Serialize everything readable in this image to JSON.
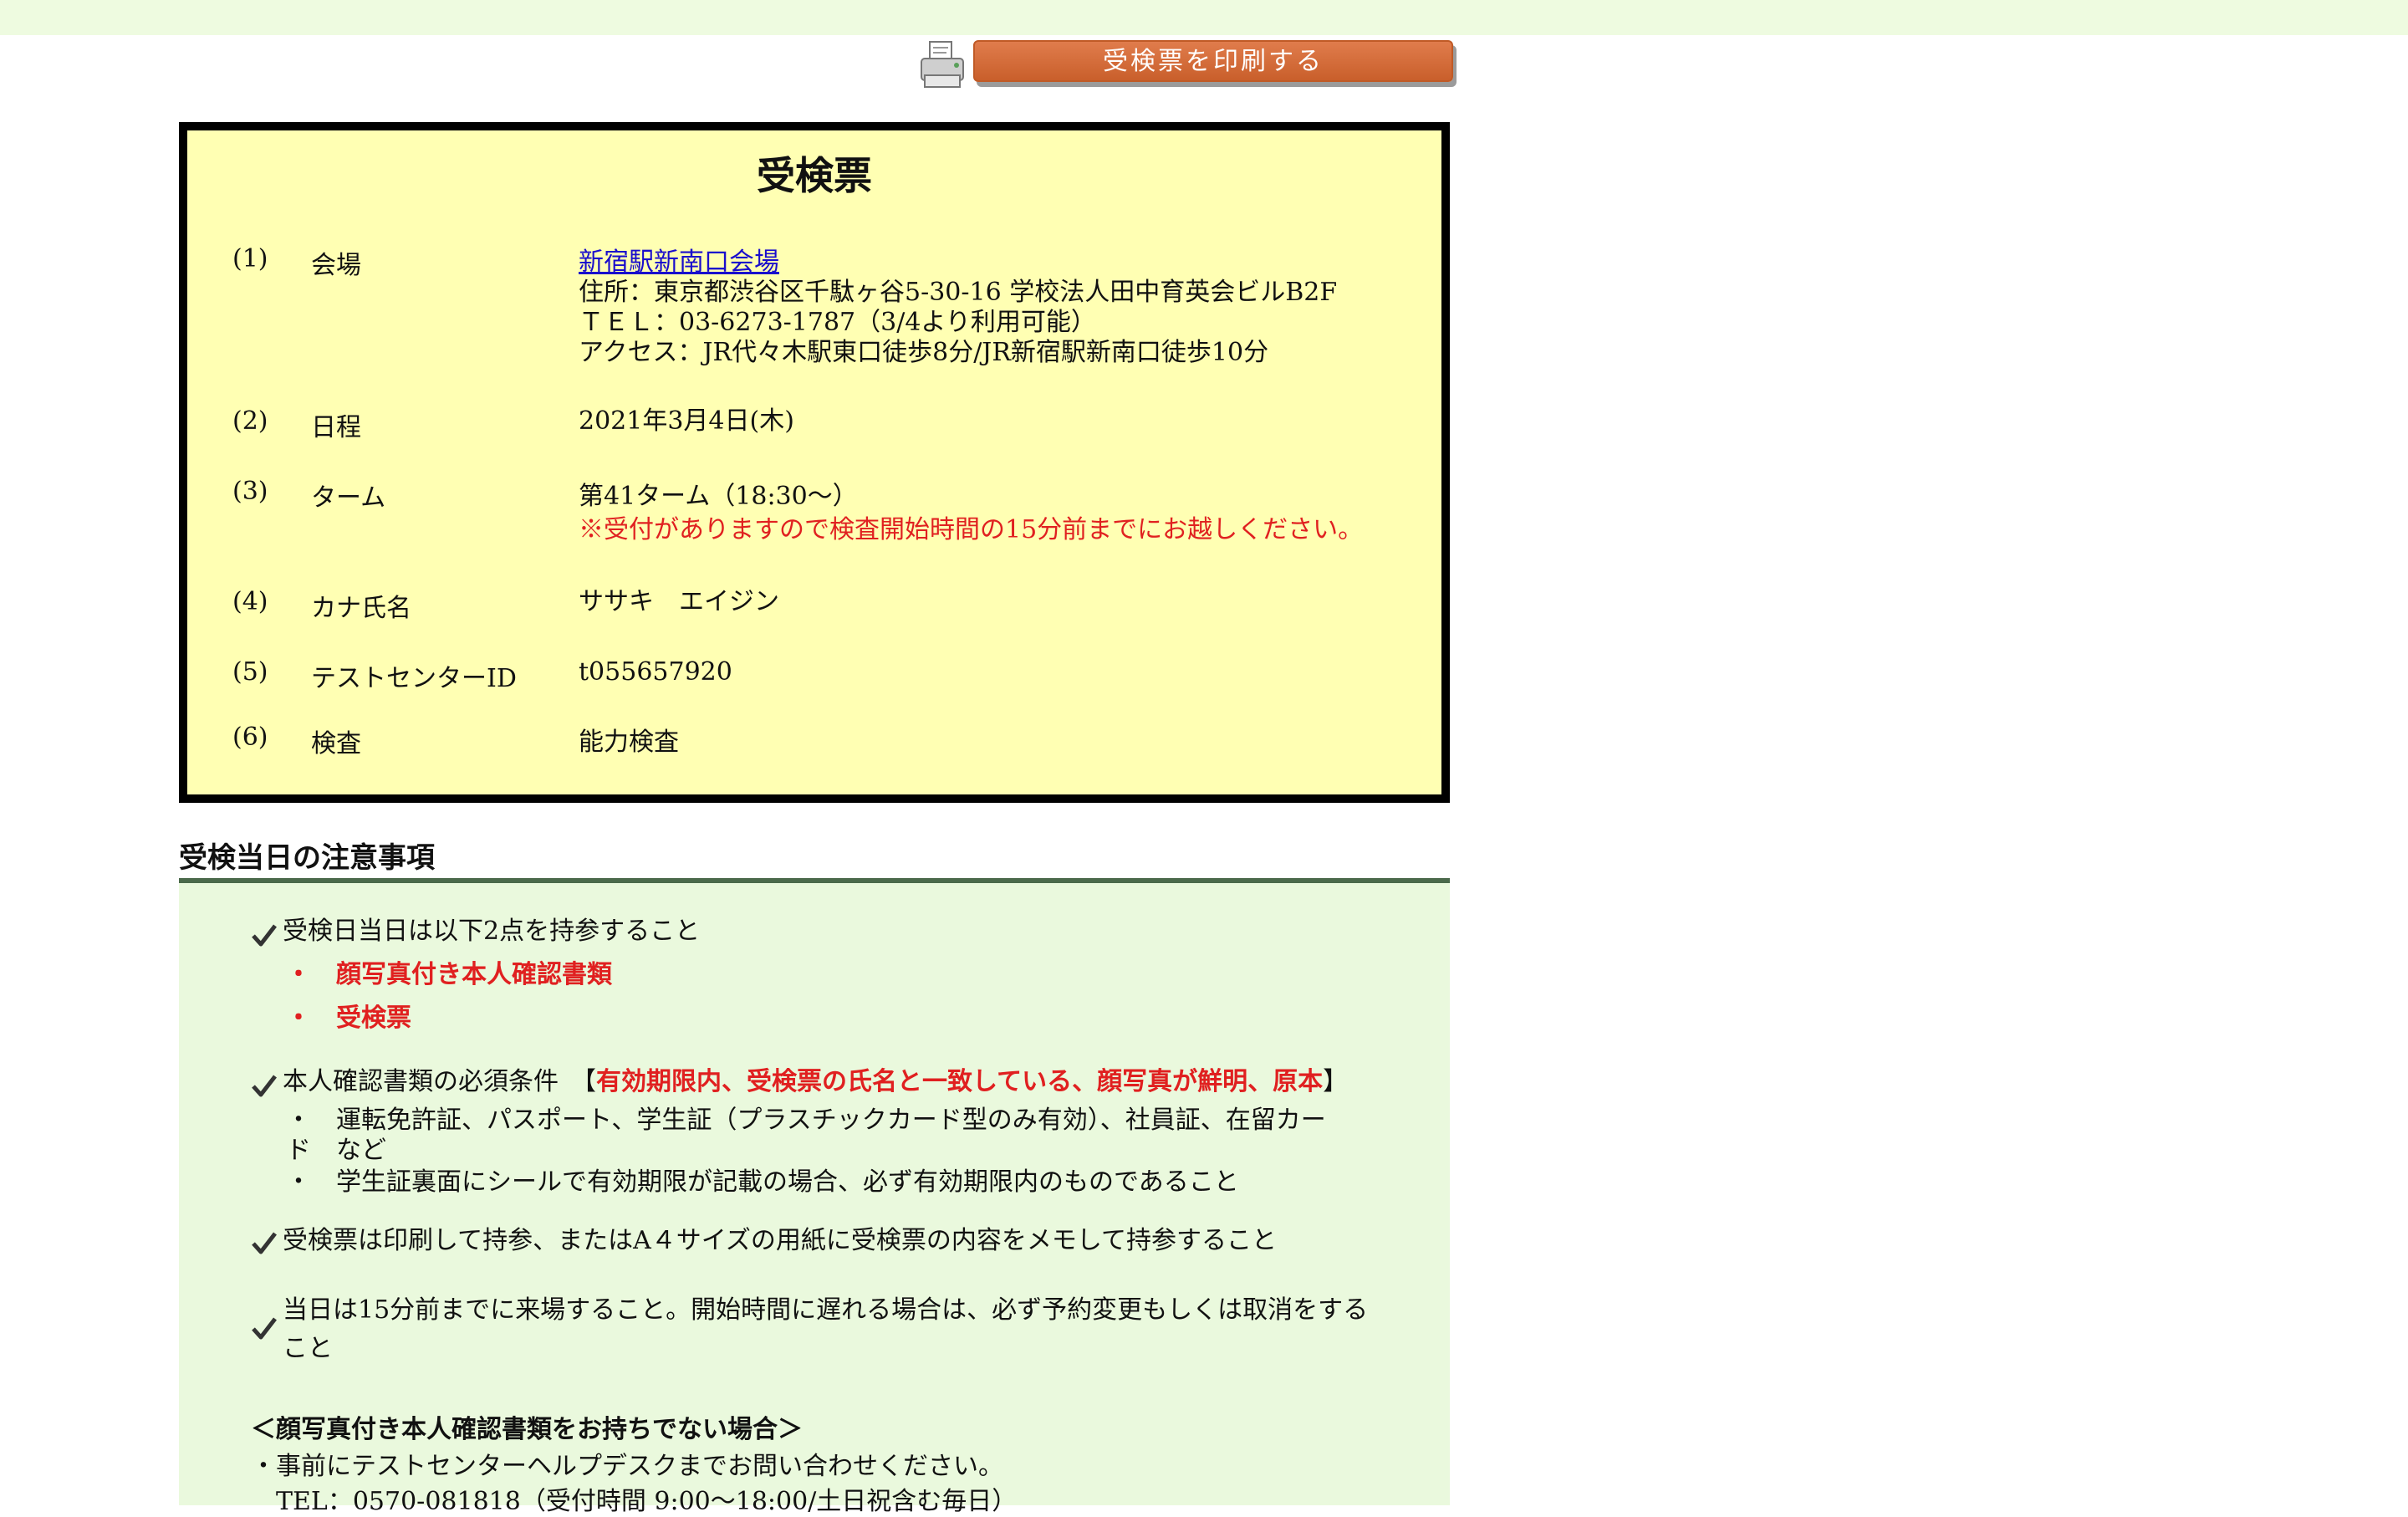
{
  "print_button": {
    "label": "受検票を印刷する"
  },
  "ticket": {
    "title": "受検票",
    "rows": [
      {
        "num": "(1)",
        "label": "会場",
        "venue_link": "新宿駅新南口会場",
        "address": "住所：東京都渋谷区千駄ヶ谷5-30-16 学校法人田中育英会ビルB2F",
        "tel": "ＴＥＬ：03-6273-1787（3/4より利用可能）",
        "access": "アクセス：JR代々木駅東口徒歩8分/JR新宿駅新南口徒歩10分"
      },
      {
        "num": "(2)",
        "label": "日程",
        "value": "2021年3月4日(木)"
      },
      {
        "num": "(3)",
        "label": "ターム",
        "value": "第41ターム（18:30〜）",
        "note": "※受付がありますので検査開始時間の15分前までにお越しください。"
      },
      {
        "num": "(4)",
        "label": "カナ氏名",
        "value": "ササキ　エイジン"
      },
      {
        "num": "(5)",
        "label": "テストセンターID",
        "value": "t055657920"
      },
      {
        "num": "(6)",
        "label": "検査",
        "value": "能力検査"
      }
    ]
  },
  "notes": {
    "heading": "受検当日の注意事項",
    "item1": {
      "text": "受検日当日は以下2点を持参すること",
      "bullets": [
        "・　顔写真付き本人確認書類",
        "・　受検票"
      ]
    },
    "item2": {
      "text": "本人確認書類の必須条件　【",
      "emphasis": "有効期限内、受検票の氏名と一致している、顔写真が鮮明、原本",
      "close": "】",
      "bullet1_line1": "・　運転免許証、パスポート、学生証（プラスチックカード型のみ有効）、社員証、在留カー",
      "bullet1_line2": "ド　など",
      "bullet2": "・　学生証裏面にシールで有効期限が記載の場合、必ず有効期限内のものであること"
    },
    "item3": {
      "text": "受検票は印刷して持参、またはA４サイズの用紙に受検票の内容をメモして持参すること"
    },
    "item4": {
      "line1": "当日は15分前までに来場すること。開始時間に遅れる場合は、必ず予約変更もしくは取消をする",
      "line2": "こと"
    },
    "no_id": {
      "heading": "＜顔写真付き本人確認書類をお持ちでない場合＞",
      "line1": "・事前にテストセンターヘルプデスクまでお問い合わせください。",
      "line2": "　TEL：0570-081818（受付時間 9:00〜18:00/土日祝含む毎日）"
    }
  },
  "colors": {
    "topbar": "#eefbe0",
    "ticket_bg": "#ffffb3",
    "notes_bg": "#eaf9dd",
    "button": "#d06a36",
    "emphasis": "#e02020",
    "link": "#1a0dcc"
  },
  "icons": [
    "printer-icon",
    "check-icon"
  ]
}
